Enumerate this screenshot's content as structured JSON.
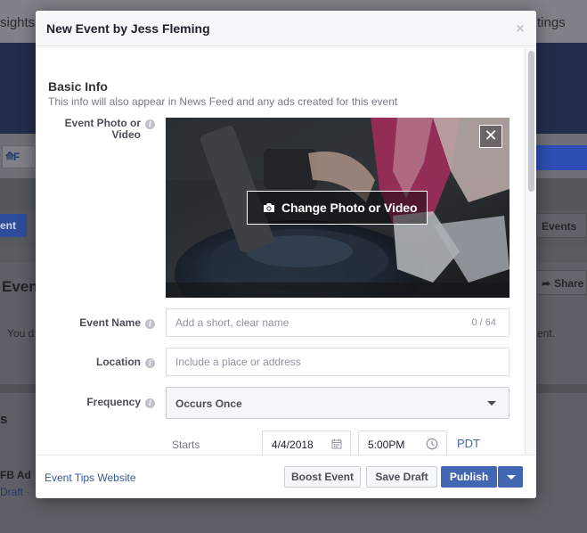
{
  "background": {
    "tab_left": "sights",
    "tab_right": "tings",
    "filter_label": "F",
    "event_button": "ent",
    "events_button": "Events",
    "event_heading": "Event",
    "share_button": "Share",
    "you_text": "You d",
    "ent_text": "ent.",
    "section_s": "s",
    "fb_ad_text": "FB Ad",
    "draft_text": "Draft ·"
  },
  "modal": {
    "title": "New Event by Jess Fleming",
    "close_glyph": "×"
  },
  "basic_info": {
    "title": "Basic Info",
    "subtitle": "This info will also appear in News Feed and any ads created for this event"
  },
  "photo": {
    "label_line1": "Event Photo or",
    "label_line2": "Video",
    "change_button": "Change Photo or Video",
    "remove_glyph": "✕"
  },
  "event_name": {
    "label": "Event Name",
    "placeholder": "Add a short, clear name",
    "counter": "0 / 64"
  },
  "location": {
    "label": "Location",
    "placeholder": "Include a place or address"
  },
  "frequency": {
    "label": "Frequency",
    "value": "Occurs Once"
  },
  "starts": {
    "label": "Starts",
    "date": "4/4/2018",
    "time": "5:00PM",
    "timezone": "PDT"
  },
  "footer": {
    "tips_link": "Event Tips Website",
    "boost_button": "Boost Event",
    "save_draft_button": "Save Draft",
    "publish_button": "Publish"
  },
  "colors": {
    "brand_blue": "#4267b2",
    "link_blue": "#365899",
    "header_bg": "#f6f7f9"
  }
}
